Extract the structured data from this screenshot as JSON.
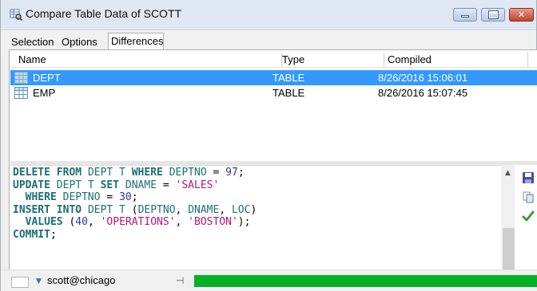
{
  "window": {
    "title": "Compare Table Data of SCOTT",
    "controls": {
      "minimize": "minimize",
      "maximize": "maximize",
      "close": "✕"
    }
  },
  "tabs": [
    {
      "label": "Selection",
      "active": false
    },
    {
      "label": "Options",
      "active": false
    },
    {
      "label": "Differences",
      "active": true
    }
  ],
  "grid": {
    "columns": [
      "Name",
      "Type",
      "Compiled"
    ],
    "rows": [
      {
        "name": "DEPT",
        "type": "TABLE",
        "compiled": "8/26/2016 15:06:01",
        "selected": true
      },
      {
        "name": "EMP",
        "type": "TABLE",
        "compiled": "8/26/2016 15:07:45",
        "selected": false
      }
    ]
  },
  "editor": {
    "lines": [
      "DELETE FROM DEPT T WHERE DEPTNO = 97;",
      "UPDATE DEPT T SET DNAME = 'SALES'",
      "  WHERE DEPTNO = 30;",
      "INSERT INTO DEPT T (DEPTNO, DNAME, LOC)",
      "  VALUES (40, 'OPERATIONS', 'BOSTON');",
      "COMMIT;"
    ]
  },
  "toolbar_icons": [
    "save-icon",
    "copy-icon",
    "apply-check-icon"
  ],
  "status": {
    "connection": "scott@chicago",
    "progress": 1.0,
    "progress_color": "#06b025",
    "selection_color": "#3399ff"
  }
}
